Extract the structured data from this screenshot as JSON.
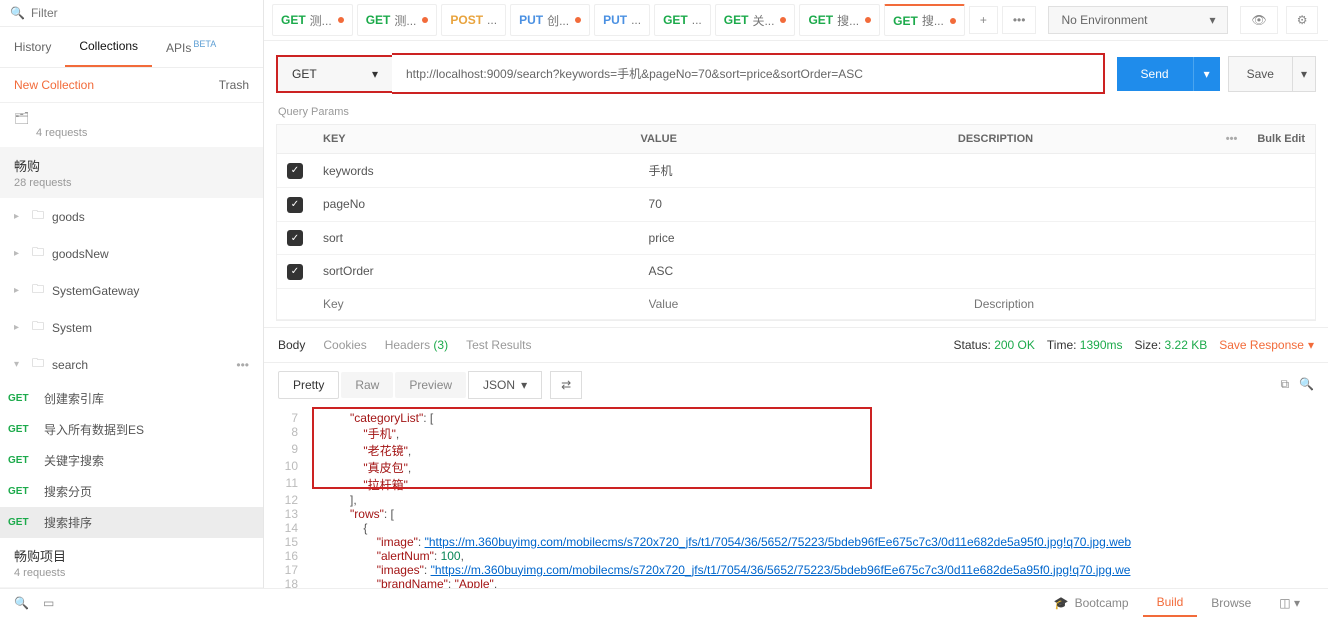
{
  "filter": {
    "placeholder": "Filter"
  },
  "nav_tabs": {
    "history": "History",
    "collections": "Collections",
    "apis": "APIs",
    "beta": "BETA"
  },
  "new_collection": {
    "label": "New Collection",
    "trash": "Trash"
  },
  "collections": [
    {
      "title": "",
      "sub": "4 requests"
    },
    {
      "title": "畅购",
      "sub": "28 requests"
    }
  ],
  "folders": [
    "goods",
    "goodsNew",
    "SystemGateway",
    "System",
    "search"
  ],
  "search_requests": [
    {
      "method": "GET",
      "name": "创建索引库"
    },
    {
      "method": "GET",
      "name": "导入所有数据到ES"
    },
    {
      "method": "GET",
      "name": "关键字搜索"
    },
    {
      "method": "GET",
      "name": "搜索分页"
    },
    {
      "method": "GET",
      "name": "搜索排序"
    }
  ],
  "project": {
    "title": "畅购项目",
    "sub": "4 requests"
  },
  "request_tabs": [
    {
      "methodClass": "tab-get",
      "method": "GET",
      "name": "测...",
      "dot": true
    },
    {
      "methodClass": "tab-get",
      "method": "GET",
      "name": "测...",
      "dot": true
    },
    {
      "methodClass": "tab-post",
      "method": "POST",
      "name": "...",
      "dot": false
    },
    {
      "methodClass": "tab-put",
      "method": "PUT",
      "name": "创...",
      "dot": true
    },
    {
      "methodClass": "tab-put",
      "method": "PUT",
      "name": "...",
      "dot": false
    },
    {
      "methodClass": "tab-get",
      "method": "GET",
      "name": "...",
      "dot": false
    },
    {
      "methodClass": "tab-get",
      "method": "GET",
      "name": "关...",
      "dot": true
    },
    {
      "methodClass": "tab-get",
      "method": "GET",
      "name": "搜...",
      "dot": true
    },
    {
      "methodClass": "tab-get",
      "method": "GET",
      "name": "搜...",
      "dot": true
    }
  ],
  "env": {
    "label": "No Environment"
  },
  "request": {
    "method": "GET",
    "url": "http://localhost:9009/search?keywords=手机&pageNo=70&sort=price&sortOrder=ASC",
    "send": "Send",
    "save": "Save"
  },
  "qparams_label": "Query Params",
  "params_head": {
    "key": "KEY",
    "value": "VALUE",
    "description": "DESCRIPTION",
    "bulk": "Bulk Edit"
  },
  "params": [
    {
      "checked": true,
      "key": "keywords",
      "value": "手机",
      "desc": ""
    },
    {
      "checked": true,
      "key": "pageNo",
      "value": "70",
      "desc": ""
    },
    {
      "checked": true,
      "key": "sort",
      "value": "price",
      "desc": ""
    },
    {
      "checked": true,
      "key": "sortOrder",
      "value": "ASC",
      "desc": ""
    }
  ],
  "params_placeholder": {
    "key": "Key",
    "value": "Value",
    "desc": "Description"
  },
  "response_tabs": {
    "body": "Body",
    "cookies": "Cookies",
    "headers": "Headers",
    "headers_count": "(3)",
    "tests": "Test Results"
  },
  "status": {
    "label": "Status:",
    "code": "200 OK",
    "time_label": "Time:",
    "time": "1390ms",
    "size_label": "Size:",
    "size": "3.22 KB",
    "save_resp": "Save Response"
  },
  "view_tabs": {
    "pretty": "Pretty",
    "raw": "Raw",
    "preview": "Preview",
    "json": "JSON"
  },
  "code_lines": {
    "l7_key": "\"categoryList\"",
    "l8_val": "\"手机\"",
    "l9_val": "\"老花镜\"",
    "l10_val": "\"真皮包\"",
    "l11_val": "\"拉杆箱\"",
    "l13_key": "\"rows\"",
    "l15_key": "\"image\"",
    "l15_val": "\"https://m.360buyimg.com/mobilecms/s720x720_jfs/t1/7054/36/5652/75223/5bdeb96fEe675c7c3/0d11e682de5a95f0.jpg!q70.jpg.web",
    "l16_key": "\"alertNum\"",
    "l16_val": "100",
    "l17_key": "\"images\"",
    "l17_val": "\"https://m.360buyimg.com/mobilecms/s720x720_jfs/t1/7054/36/5652/75223/5bdeb96fEe675c7c3/0d11e682de5a95f0.jpg!q70.jpg.we",
    "l18_key": "\"brandName\"",
    "l18_val": "\"Apple\""
  },
  "bottom": {
    "bootcamp": "Bootcamp",
    "build": "Build",
    "browse": "Browse"
  }
}
